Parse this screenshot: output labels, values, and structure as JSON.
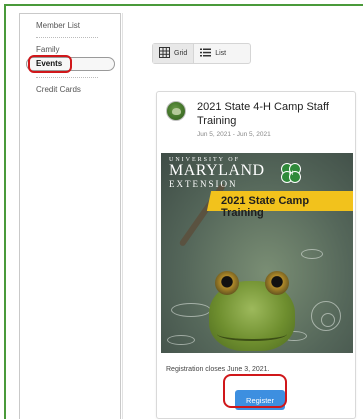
{
  "sidebar": {
    "items": [
      {
        "label": "Member List"
      },
      {
        "label": "Family"
      },
      {
        "label": "Events",
        "active": true
      },
      {
        "label": "Credit Cards"
      }
    ]
  },
  "view_toggle": {
    "options": [
      {
        "label": "Grid",
        "icon": "grid-icon",
        "active": true
      },
      {
        "label": "List",
        "icon": "list-icon",
        "active": false
      }
    ]
  },
  "event": {
    "title": "2021 State 4-H Camp Staff Training",
    "dates": "Jun 5, 2021 - Jun 5, 2021",
    "image": {
      "org_line1": "UNIVERSITY OF",
      "org_line2": "MARYLAND",
      "org_line3": "EXTENSION",
      "banner": "2021 State Camp Training"
    },
    "registration_note": "Registration closes June 3, 2021.",
    "register_label": "Register"
  },
  "colors": {
    "accent_green": "#4a9a3a",
    "highlight_red": "#d0171a",
    "button_blue": "#3d8fe0",
    "banner_yellow": "#f2c21c"
  }
}
